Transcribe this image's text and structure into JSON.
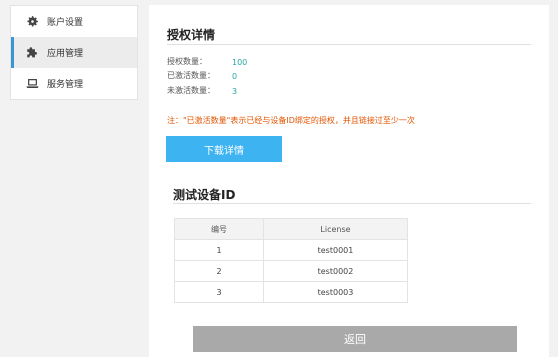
{
  "sidebar": {
    "items": [
      {
        "label": "账户设置",
        "icon": "gear-icon",
        "active": false
      },
      {
        "label": "应用管理",
        "icon": "puzzle-icon",
        "active": true
      },
      {
        "label": "服务管理",
        "icon": "laptop-icon",
        "active": false
      }
    ],
    "accent": "#3a97d4"
  },
  "main": {
    "title": "授权详情",
    "stats": [
      {
        "label": "授权数量：",
        "value": "100"
      },
      {
        "label": "已激活数量：",
        "value": "0"
      },
      {
        "label": "未激活数量：",
        "value": "3"
      }
    ],
    "note": "注：\"已激活数量\"表示已经与设备ID绑定的授权，并且链接过至少一次",
    "download_button": "下载详情",
    "device_section_title": "测试设备ID",
    "table": {
      "columns": [
        "编号",
        "License"
      ],
      "rows": [
        [
          "1",
          "test0001"
        ],
        [
          "2",
          "test0002"
        ],
        [
          "3",
          "test0003"
        ]
      ]
    },
    "back_button": "返回"
  },
  "colors": {
    "download_button": "#3eb3f1",
    "back_button": "#a9a9a9",
    "stat_value": "#2aa6a0",
    "note": "#e35400"
  }
}
